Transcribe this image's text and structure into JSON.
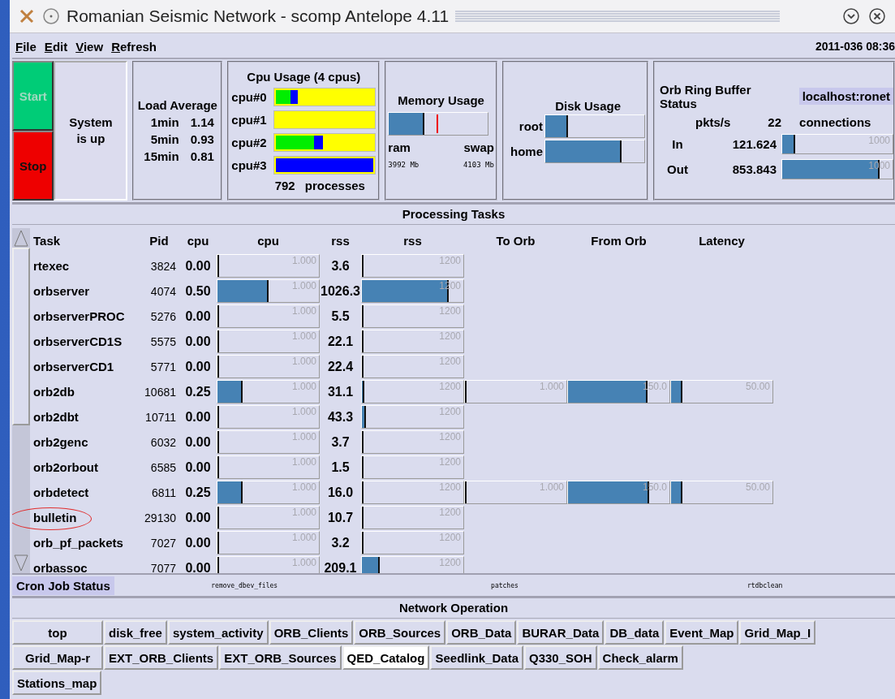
{
  "window": {
    "title": "Romanian Seismic Network - scomp Antelope 4.11"
  },
  "menu": [
    {
      "label": "File"
    },
    {
      "label": "Edit"
    },
    {
      "label": "View"
    },
    {
      "label": "Refresh"
    }
  ],
  "timestamp": "2011-036 08:36",
  "controls": [
    {
      "label": "Start",
      "kind": "start",
      "disabled": true
    },
    {
      "label": "Stop",
      "kind": "stop",
      "disabled": false
    }
  ],
  "system_status": "System is up",
  "load_average": {
    "title": "Load Average",
    "rows": [
      {
        "label": "1min",
        "value": "1.14"
      },
      {
        "label": "5min",
        "value": "0.93"
      },
      {
        "label": "15min",
        "value": "0.81"
      }
    ]
  },
  "cpu_usage": {
    "title": "Cpu Usage (4 cpus)",
    "cpus": [
      {
        "label": "cpu#0",
        "busy": {
          "level": 0.22
        },
        "user": {
          "level": 0.15
        }
      },
      {
        "label": "cpu#1"
      },
      {
        "label": "cpu#2",
        "busy": {
          "level": 0.48
        },
        "user": {
          "level": 0.39
        }
      },
      {
        "label": "cpu#3",
        "busy": {
          "level": 1
        }
      }
    ],
    "process_count": "792",
    "process_label": "processes"
  },
  "memory": {
    "title": "Memory Usage",
    "level": 0.36,
    "marker": {
      "level": 0.48
    },
    "columns": [
      {
        "label": "ram",
        "value": "3992 Mb"
      },
      {
        "label": "swap",
        "value": "4103 Mb"
      }
    ]
  },
  "disk": {
    "title": "Disk Usage",
    "volumes": [
      {
        "label": "root",
        "level": 0.23
      },
      {
        "label": "home",
        "level": 0.77
      }
    ]
  },
  "orb": {
    "title": "Orb Ring Buffer Status",
    "host": "localhost:ronet",
    "rate_label": "pkts/s",
    "connections_count": "22",
    "connections_label": "connections",
    "rows": [
      {
        "label": "In",
        "value": "121.624",
        "max": "1000",
        "level": 0.12
      },
      {
        "label": "Out",
        "value": "853.843",
        "max": "1000",
        "level": 0.88
      }
    ]
  },
  "tasks": {
    "title": "Processing Tasks",
    "columns": [
      "Task",
      "Pid",
      "cpu",
      "cpu",
      "rss",
      "rss",
      "To Orb",
      "From Orb",
      "Latency"
    ],
    "rows": [
      {
        "task": "rtexec",
        "pid": "3824",
        "cpu": "0.00",
        "cpu_bar": {
          "max": "1.000",
          "level": 0
        },
        "rss": "3.6",
        "rss_bar": {
          "max": "1200",
          "level": 0.003
        },
        "circled": false
      },
      {
        "task": "orbserver",
        "pid": "4074",
        "cpu": "0.50",
        "cpu_bar": {
          "max": "1.000",
          "level": 0.5
        },
        "rss": "1026.3",
        "rss_bar": {
          "max": "1200",
          "level": 0.855
        },
        "circled": false
      },
      {
        "task": "orbserverPROC",
        "pid": "5276",
        "cpu": "0.00",
        "cpu_bar": {
          "max": "1.000",
          "level": 0
        },
        "rss": "5.5",
        "rss_bar": {
          "max": "1200",
          "level": 0.005
        },
        "circled": false
      },
      {
        "task": "orbserverCD1S",
        "pid": "5575",
        "cpu": "0.00",
        "cpu_bar": {
          "max": "1.000",
          "level": 0
        },
        "rss": "22.1",
        "rss_bar": {
          "max": "1200",
          "level": 0.018
        },
        "circled": false
      },
      {
        "task": "orbserverCD1",
        "pid": "5771",
        "cpu": "0.00",
        "cpu_bar": {
          "max": "1.000",
          "level": 0
        },
        "rss": "22.4",
        "rss_bar": {
          "max": "1200",
          "level": 0.019
        },
        "circled": false
      },
      {
        "task": "orb2db",
        "pid": "10681",
        "cpu": "0.25",
        "cpu_bar": {
          "max": "1.000",
          "level": 0.25
        },
        "rss": "31.1",
        "rss_bar": {
          "max": "1200",
          "level": 0.026
        },
        "orb": {
          "to": {
            "max": "1.000",
            "level": 0
          },
          "from": {
            "max": "150.0",
            "level": 0.78
          },
          "latency": {
            "max": "50.00",
            "level": 0.11
          }
        },
        "circled": false
      },
      {
        "task": "orb2dbt",
        "pid": "10711",
        "cpu": "0.00",
        "cpu_bar": {
          "max": "1.000",
          "level": 0
        },
        "rss": "43.3",
        "rss_bar": {
          "max": "1200",
          "level": 0.036
        },
        "circled": false
      },
      {
        "task": "orb2genc",
        "pid": "6032",
        "cpu": "0.00",
        "cpu_bar": {
          "max": "1.000",
          "level": 0
        },
        "rss": "3.7",
        "rss_bar": {
          "max": "1200",
          "level": 0.003
        },
        "circled": false
      },
      {
        "task": "orb2orbout",
        "pid": "6585",
        "cpu": "0.00",
        "cpu_bar": {
          "max": "1.000",
          "level": 0
        },
        "rss": "1.5",
        "rss_bar": {
          "max": "1200",
          "level": 0.001
        },
        "circled": false
      },
      {
        "task": "orbdetect",
        "pid": "6811",
        "cpu": "0.25",
        "cpu_bar": {
          "max": "1.000",
          "level": 0.25
        },
        "rss": "16.0",
        "rss_bar": {
          "max": "1200",
          "level": 0.013
        },
        "orb": {
          "to": {
            "max": "1.000",
            "level": 0
          },
          "from": {
            "max": "150.0",
            "level": 0.8
          },
          "latency": {
            "max": "50.00",
            "level": 0.11
          }
        },
        "circled": false
      },
      {
        "task": "bulletin",
        "pid": "29130",
        "cpu": "0.00",
        "cpu_bar": {
          "max": "1.000",
          "level": 0
        },
        "rss": "10.7",
        "rss_bar": {
          "max": "1200",
          "level": 0.009
        },
        "circled": true
      },
      {
        "task": "orb_pf_packets",
        "pid": "7027",
        "cpu": "0.00",
        "cpu_bar": {
          "max": "1.000",
          "level": 0
        },
        "rss": "3.2",
        "rss_bar": {
          "max": "1200",
          "level": 0.003
        },
        "circled": false
      },
      {
        "task": "orbassoc",
        "pid": "7077",
        "cpu": "0.00",
        "cpu_bar": {
          "max": "1.000",
          "level": 0
        },
        "rss": "209.1",
        "rss_bar": {
          "max": "1200",
          "level": 0.174
        },
        "circled": false
      }
    ]
  },
  "cron": {
    "label": "Cron Job Status",
    "jobs": [
      "remove_dbev_files",
      "patches",
      "rtdbclean"
    ]
  },
  "network": {
    "title": "Network Operation",
    "rows": [
      {
        "buttons": [
          {
            "label": "top",
            "selected": false
          },
          {
            "label": "disk_free",
            "selected": false
          },
          {
            "label": "system_activity",
            "selected": false
          },
          {
            "label": "ORB_Clients",
            "selected": false
          },
          {
            "label": "ORB_Sources",
            "selected": false
          },
          {
            "label": "ORB_Data",
            "selected": false
          },
          {
            "label": "BURAR_Data",
            "selected": false
          },
          {
            "label": "DB_data",
            "selected": false
          },
          {
            "label": "Event_Map",
            "selected": false
          },
          {
            "label": "Grid_Map_I",
            "selected": false
          }
        ]
      },
      {
        "buttons": [
          {
            "label": "Grid_Map-r",
            "selected": false
          },
          {
            "label": "EXT_ORB_Clients",
            "selected": false
          },
          {
            "label": "EXT_ORB_Sources",
            "selected": false
          },
          {
            "label": "QED_Catalog",
            "selected": true
          },
          {
            "label": "Seedlink_Data",
            "selected": false
          },
          {
            "label": "Q330_SOH",
            "selected": false
          },
          {
            "label": "Check_alarm",
            "selected": false
          }
        ]
      },
      {
        "buttons": [
          {
            "label": "Stations_map",
            "selected": false
          }
        ]
      }
    ]
  }
}
